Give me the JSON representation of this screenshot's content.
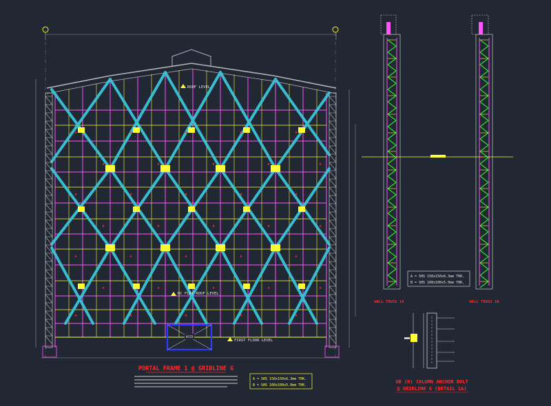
{
  "drawing": {
    "frame_title": "PORTAL FRAME 1 @ GRIDLINE G",
    "roof_level": "ROOF LEVEL",
    "rc_flat_roof_level": "RC FLAT ROOF LEVEL",
    "first_floor_level": "FIRST FLOOR LEVEL",
    "wall_truss_a": "WALL TRUSS 1A",
    "wall_truss_b": "WALL TRUSS 1B",
    "anchor_title_1": "UB (H) COLUMN ANCHOR BOLT",
    "anchor_title_2": "@ GRIDLINE G (DETAIL 1A)",
    "legend_left_a": "A = SHS 150x150x6.3mm THK.",
    "legend_left_b": "B = SHS 100x100x5.0mm THK.",
    "legend_right_a": "A = SHS 150x150x6.3mm THK.",
    "legend_right_b": "B = SHS 100x100x5.0mm THK.",
    "void_label": "VOID"
  },
  "colors": {
    "background": "#212833",
    "cyan_bracing": "#39c6d8",
    "magenta_members": "#ff55ff",
    "yellow_members": "#ffff33",
    "green_truss": "#22ee22",
    "red_text": "#ff2b2b",
    "blue_void": "#2b3bff",
    "grey_lines": "#b5b5b5"
  },
  "icons": {
    "gridline_bubble": "gridline-circle-icon",
    "level_marker": "level-triangle-icon",
    "node_marker": "red-triangle-icon"
  }
}
